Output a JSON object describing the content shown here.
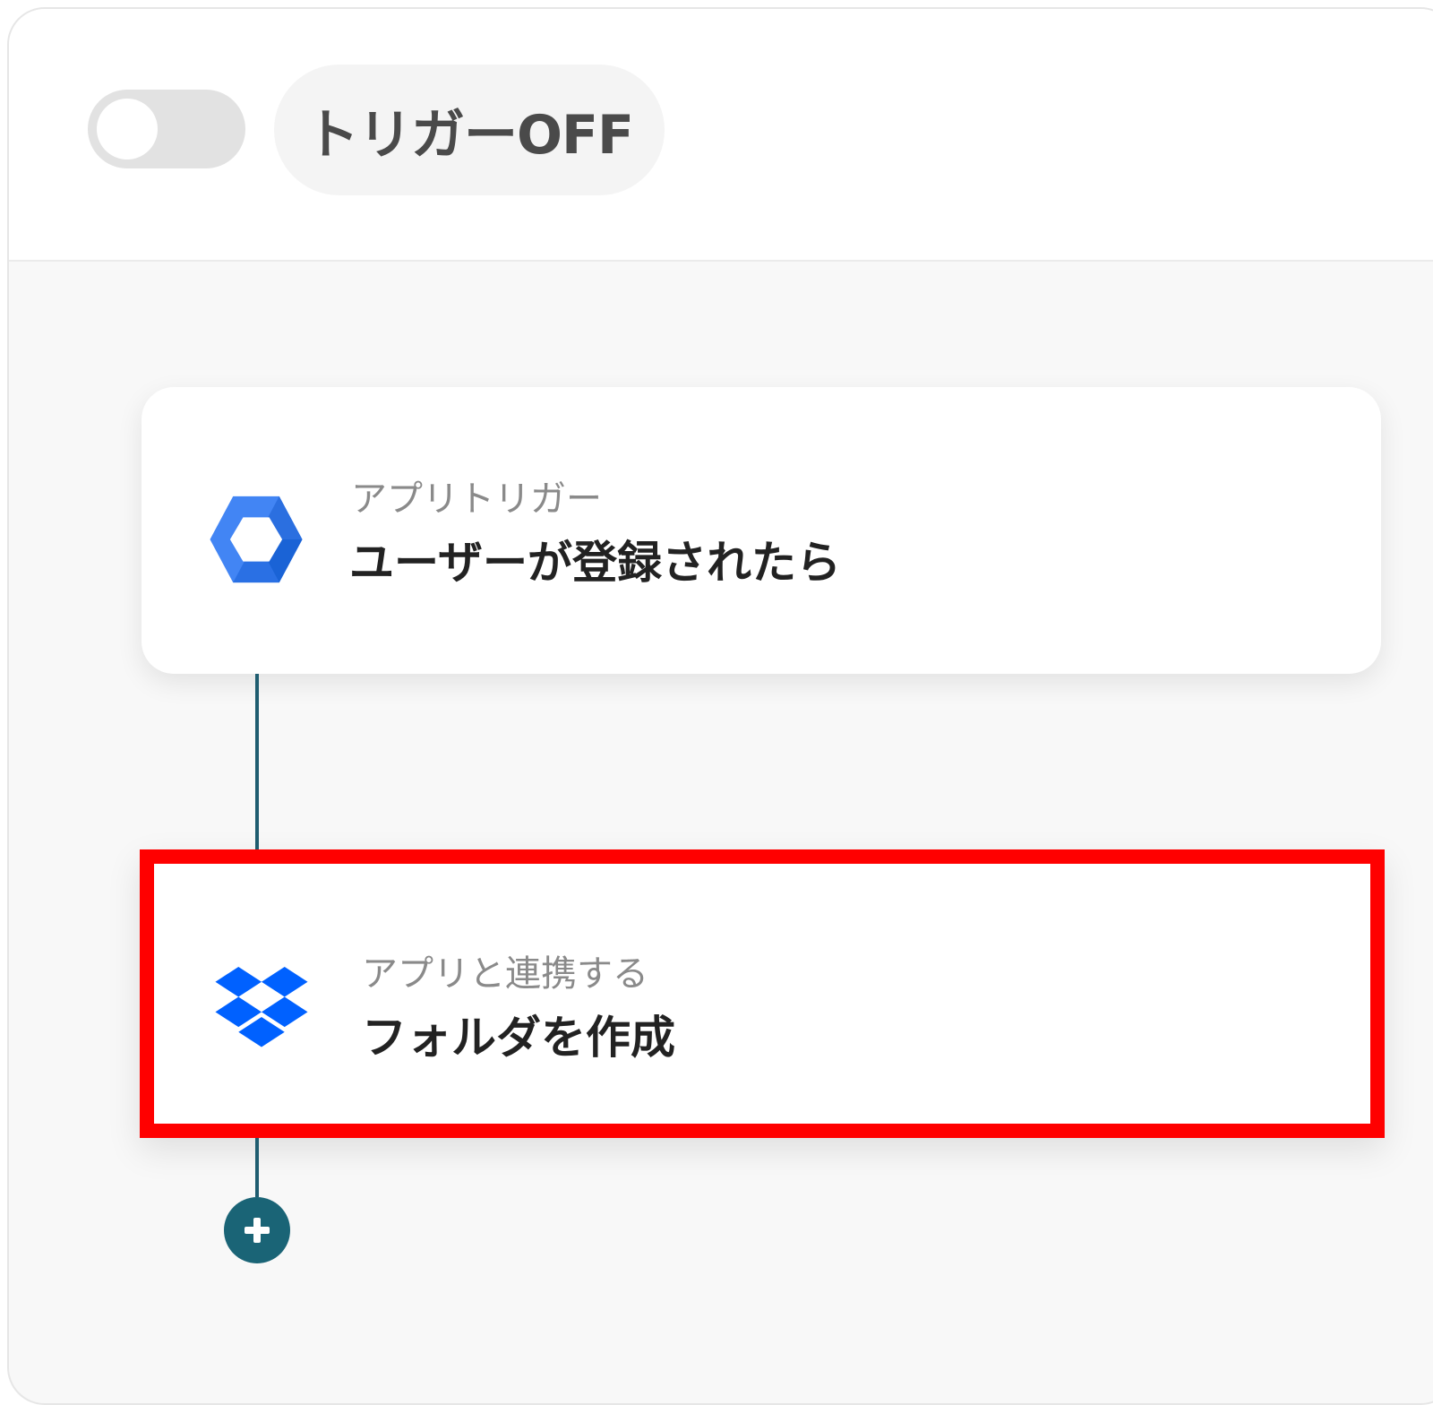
{
  "header": {
    "trigger_toggle": {
      "state": "off"
    },
    "trigger_label": "トリガーOFF"
  },
  "flow": {
    "steps": [
      {
        "subtitle": "アプリトリガー",
        "title": "ユーザーが登録されたら",
        "icon": "google-workspace-admin-icon",
        "highlighted": false
      },
      {
        "subtitle": "アプリと連携する",
        "title": "フォルダを作成",
        "icon": "dropbox-icon",
        "highlighted": true
      }
    ],
    "add_step_icon": "plus-icon"
  },
  "colors": {
    "highlight_border": "#ff0000",
    "connector": "#1f5d70",
    "add_button": "#1a6476",
    "google_blue_light": "#4285f4",
    "google_blue_dark": "#1a63d6",
    "dropbox_blue": "#0061ff"
  }
}
